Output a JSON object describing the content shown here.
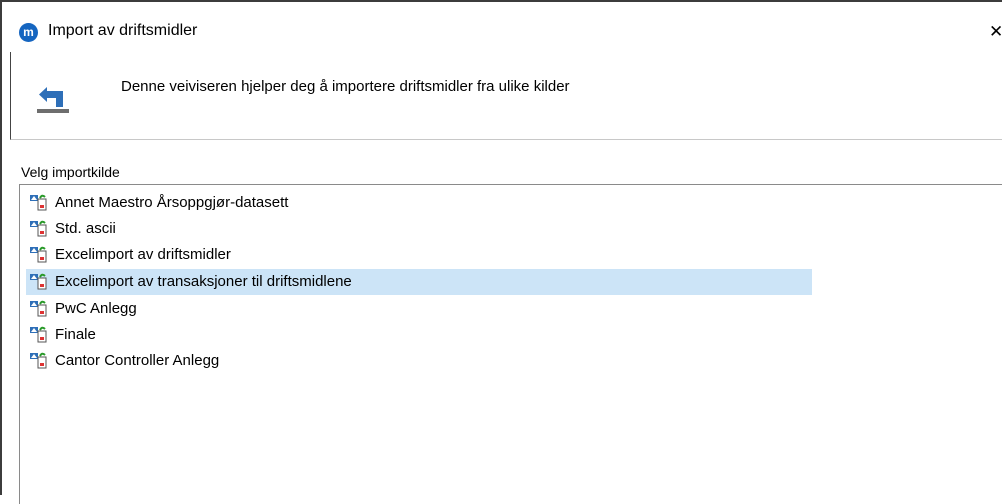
{
  "window": {
    "title": "Import av driftsmidler",
    "logo_letter": "m",
    "close_glyph": "✕"
  },
  "header": {
    "description": "Denne veiviseren hjelper deg å importere driftsmidler fra ulike kilder",
    "icon": "import-arrow-icon"
  },
  "source_list": {
    "label": "Velg importkilde",
    "selected_index": 3,
    "selection_color": "#cce4f7",
    "items": [
      {
        "label": "Annet Maestro Årsoppgjør-datasett",
        "icon": "import-source-icon"
      },
      {
        "label": "Std. ascii",
        "icon": "import-source-icon"
      },
      {
        "label": "Excelimport av driftsmidler",
        "icon": "import-source-icon"
      },
      {
        "label": "Excelimport av transaksjoner til driftsmidlene",
        "icon": "import-source-icon"
      },
      {
        "label": "PwC Anlegg",
        "icon": "import-source-icon"
      },
      {
        "label": "Finale",
        "icon": "import-source-icon"
      },
      {
        "label": "Cantor Controller Anlegg",
        "icon": "import-source-icon"
      }
    ]
  },
  "colors": {
    "logo_blue": "#1565c0",
    "icon_blue": "#2e6fb8"
  }
}
